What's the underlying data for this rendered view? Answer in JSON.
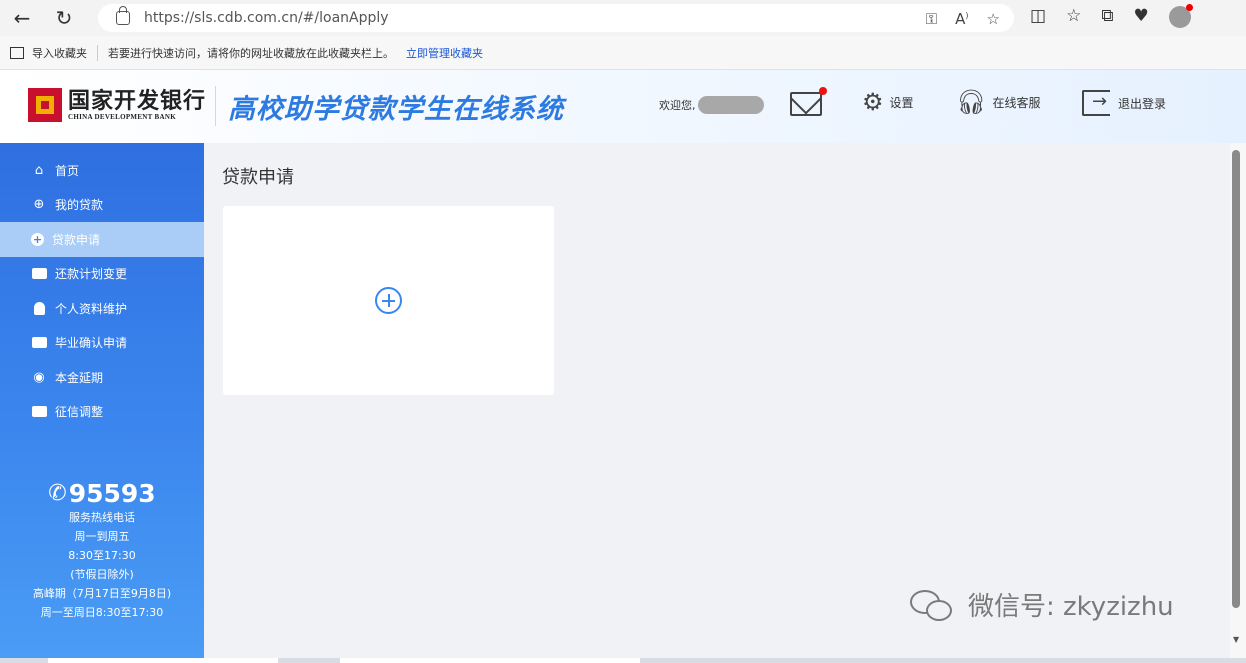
{
  "browser": {
    "url": "https://sls.cdb.com.cn/#/loanApply",
    "fav_import": "导入收藏夹",
    "fav_tip": "若要进行快速访问，请将你的网址收藏放在此收藏夹栏上。",
    "fav_manage": "立即管理收藏夹"
  },
  "header": {
    "bank_name_cn": "国家开发银行",
    "bank_name_en": "CHINA DEVELOPMENT BANK",
    "system_title": "高校助学贷款学生在线系统",
    "welcome": "欢迎您,",
    "settings": "设置",
    "service": "在线客服",
    "logout": "退出登录"
  },
  "sidebar": {
    "items": [
      {
        "label": "首页",
        "icon": "home-icon"
      },
      {
        "label": "我的贷款",
        "icon": "loan-icon"
      },
      {
        "label": "贷款申请",
        "icon": "apply-icon",
        "active": true
      },
      {
        "label": "还款计划变更",
        "icon": "card-icon"
      },
      {
        "label": "个人资料维护",
        "icon": "user-icon"
      },
      {
        "label": "毕业确认申请",
        "icon": "id-card-icon"
      },
      {
        "label": "本金延期",
        "icon": "circle-icon"
      },
      {
        "label": "征信调整",
        "icon": "credit-icon"
      }
    ],
    "hotline": {
      "number": "95593",
      "label": "服务热线电话",
      "days": "周一到周五",
      "hours": "8:30至17:30",
      "holiday": "(节假日除外)",
      "peak": "高峰期（7月17日至9月8日)",
      "peak_hours": "周一至周日8:30至17:30"
    }
  },
  "main": {
    "title": "贷款申请"
  },
  "watermark": "微信号: zkyzizhu",
  "colors": {
    "accent": "#2f6fe0",
    "active_item": "#a9cdf6",
    "title": "#2d7be0",
    "badge": "#e11111"
  }
}
